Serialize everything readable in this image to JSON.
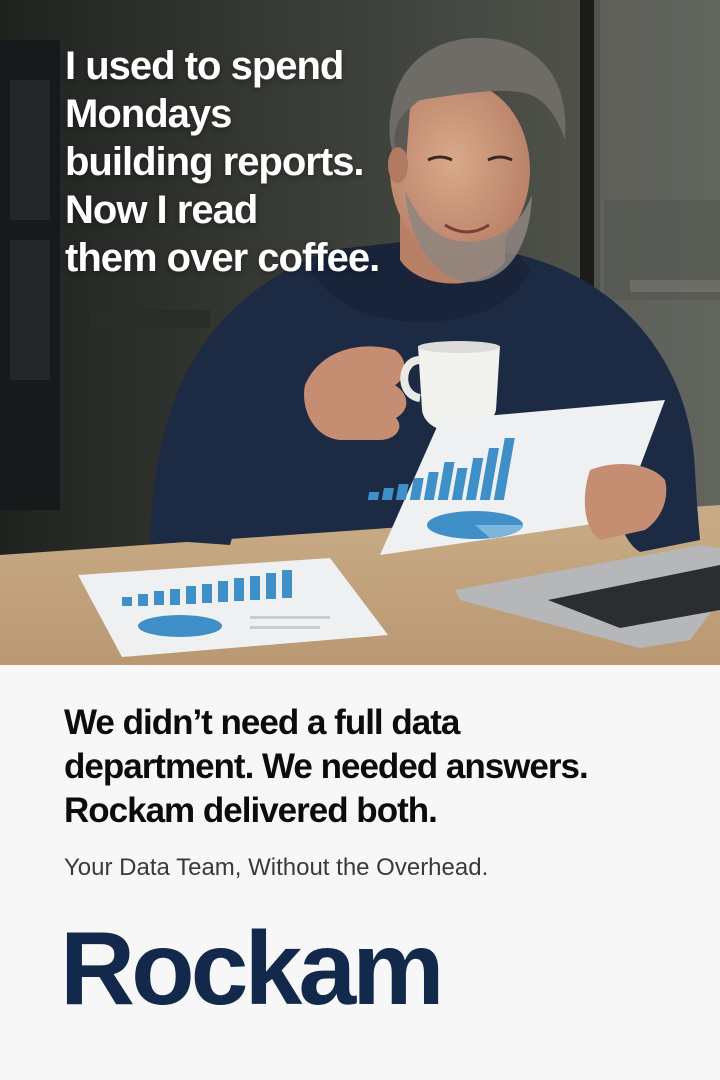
{
  "headline": {
    "lines": [
      "I used to spend",
      "Mondays",
      "building reports.",
      "Now I read",
      "them over coffee."
    ]
  },
  "testimonial": {
    "lines": [
      "We didn’t need a full data",
      "department. We needed answers.",
      "Rockam delivered both."
    ]
  },
  "tagline": "Your Data Team, Without the Overhead.",
  "brand": {
    "name": "Rockam",
    "color": "#13294b"
  },
  "colors": {
    "headline_text": "#ffffff",
    "body_text": "#0c0c0c",
    "tagline_text": "#3a3a3a",
    "panel_background": "#f7f7f7",
    "chart_blue": "#3f8fc9"
  }
}
